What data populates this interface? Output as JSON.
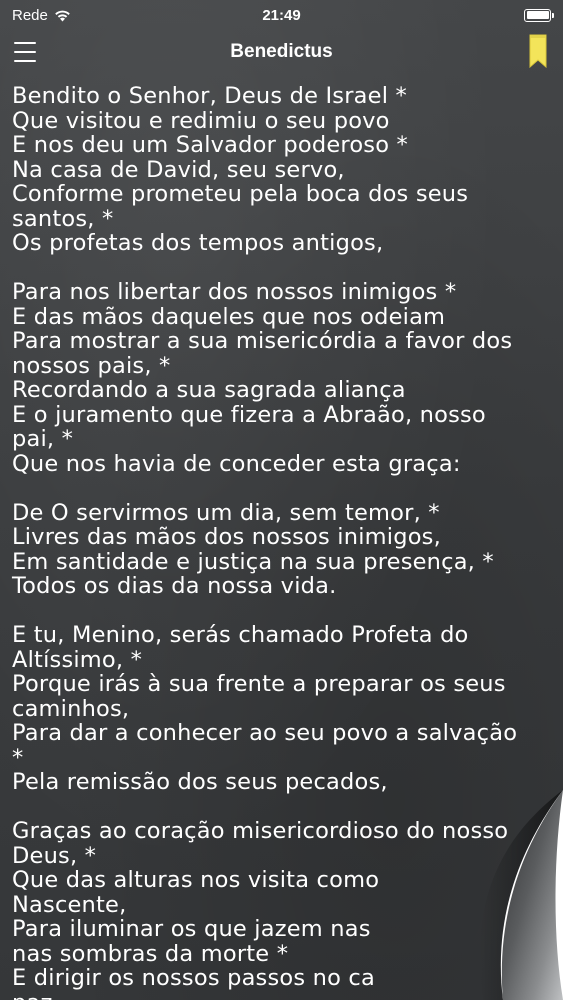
{
  "status_bar": {
    "carrier": "Rede",
    "time": "21:49"
  },
  "nav": {
    "title": "Benedictus",
    "menu_icon": "hamburger-menu-icon",
    "bookmark_icon": "bookmark-icon",
    "bookmark_color": "#f3e45a"
  },
  "text": {
    "stanzas": [
      [
        "Bendito o Senhor, Deus de Israel *",
        "Que visitou e redimiu o seu povo",
        "E nos deu um Salvador poderoso *",
        "Na casa de David, seu servo,",
        "Conforme prometeu pela boca dos seus",
        "santos, *",
        "Os profetas dos tempos antigos,"
      ],
      [
        "Para nos libertar dos nossos inimigos *",
        "E das mãos daqueles que nos odeiam",
        "Para mostrar a sua misericórdia a favor dos",
        "nossos pais, *",
        "Recordando a sua sagrada aliança",
        "E o juramento que fizera a Abraão, nosso",
        "pai, *",
        "Que nos havia de conceder esta graça:"
      ],
      [
        "De O servirmos um dia, sem temor, *",
        "Livres das mãos dos nossos inimigos,",
        "Em santidade e justiça na sua presença, *",
        "Todos os dias da nossa vida."
      ],
      [
        "E tu, Menino, serás chamado Profeta do",
        "Altíssimo, *",
        "Porque irás à sua frente a preparar os seus",
        "caminhos,",
        "Para dar a conhecer ao seu povo a salvação",
        "*",
        "Pela remissão dos seus pecados,"
      ],
      [
        "Graças ao coração misericordioso do nosso",
        "Deus, *",
        "Que das alturas nos visita como",
        "Nascente,",
        "Para iluminar os que jazem nas",
        "nas sombras da morte *",
        "E dirigir os nossos passos no ca",
        "paz."
      ]
    ]
  }
}
